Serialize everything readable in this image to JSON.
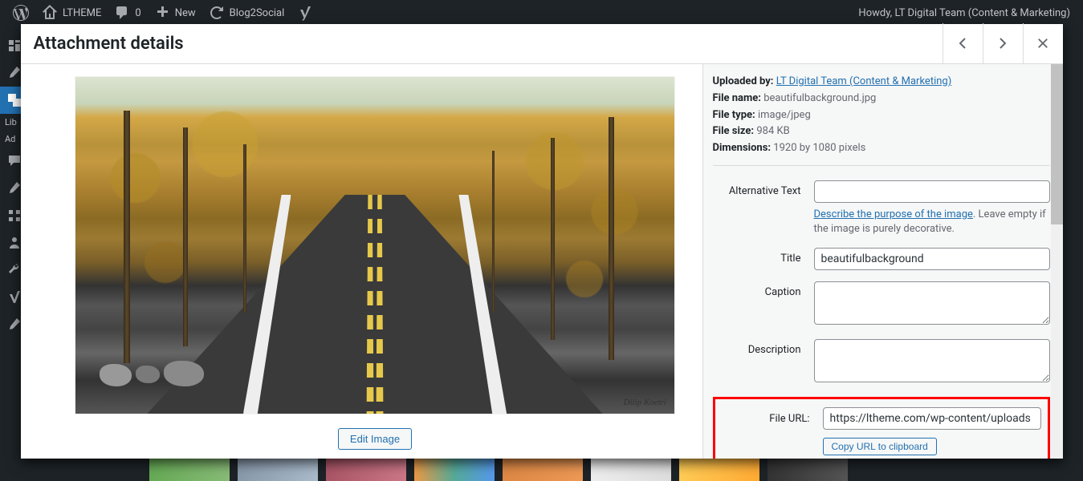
{
  "adminbar": {
    "site_name": "LTHEME",
    "comments": "0",
    "new_label": "New",
    "blog2social": "Blog2Social",
    "howdy": "Howdy, LT Digital Team (Content & Marketing)"
  },
  "sidebar": {
    "library": "Lib",
    "add": "Ad"
  },
  "modal": {
    "title": "Attachment details"
  },
  "meta": {
    "uploaded_by_label": "Uploaded by:",
    "uploaded_by_value": "LT Digital Team (Content & Marketing)",
    "file_name_label": "File name:",
    "file_name_value": "beautifulbackground.jpg",
    "file_type_label": "File type:",
    "file_type_value": "image/jpeg",
    "file_size_label": "File size:",
    "file_size_value": "984 KB",
    "dimensions_label": "Dimensions:",
    "dimensions_value": "1920 by 1080 pixels"
  },
  "form": {
    "alt_label": "Alternative Text",
    "alt_value": "",
    "alt_help_link": "Describe the purpose of the image",
    "alt_help_rest": ". Leave empty if the image is purely decorative.",
    "title_label": "Title",
    "title_value": "beautifulbackground",
    "caption_label": "Caption",
    "caption_value": "",
    "description_label": "Description",
    "description_value": "",
    "fileurl_label": "File URL:",
    "fileurl_value": "https://ltheme.com/wp-content/uploads",
    "copy_label": "Copy URL to clipboard"
  },
  "buttons": {
    "edit_image": "Edit Image"
  },
  "image": {
    "signature": "Dilip Koetri"
  }
}
